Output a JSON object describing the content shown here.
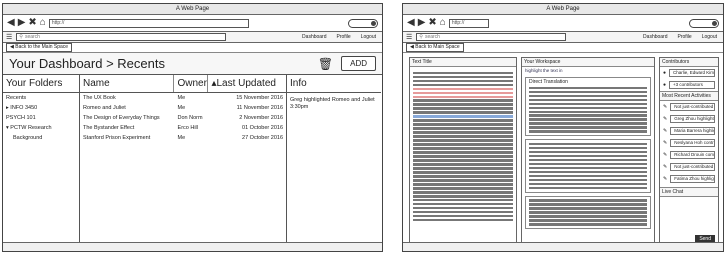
{
  "window": {
    "title": "A Web Page",
    "url": "http://"
  },
  "appbar": {
    "search_placeholder": "search",
    "links": [
      "Dashboard",
      "Profile",
      "Logout"
    ]
  },
  "crumb": {
    "back_label": "Back to the Main Space"
  },
  "dashboard": {
    "title": "Your Dashboard > Recents",
    "add_label": "ADD"
  },
  "folders": {
    "header": "Your Folders",
    "items": [
      "Recents",
      "▸ INFO 3450",
      "PSYCH 101",
      "▾ PCTW Research",
      "Background"
    ]
  },
  "table": {
    "headers": [
      "Name",
      "Owner",
      "▴Last Updated"
    ],
    "rows": [
      [
        "The UX Book",
        "Me",
        "15 November 2016"
      ],
      [
        "Romeo and Juliet",
        "Me",
        "11 November 2016"
      ],
      [
        "The Design of Everyday Things",
        "Don Norm",
        "2 November 2016"
      ],
      [
        "The Bystander Effect",
        "Erco Hill",
        "01 October 2016"
      ],
      [
        "Stanford Prison Experiment",
        "Me",
        "27 October 2016"
      ]
    ]
  },
  "info": {
    "header": "Info",
    "text": "Greg highlighted Romeo and Juliet 3:30pm"
  },
  "right": {
    "title": "A Web Page",
    "search_placeholder": "search",
    "links": [
      "Dashboard",
      "Profile",
      "Logout"
    ],
    "back_label": "Back to Main Space",
    "text_title": "Text Title",
    "workspace_title": "Your Workspace",
    "workspace_note": "highlight the text in",
    "direct_translation": "Direct Translation",
    "contributors_title": "Contributors",
    "contributors": [
      "Charlie, Edward Kim",
      "+3 contributors"
    ],
    "recent_title": "Most Recent Activities",
    "activities": [
      "Not just-contributed",
      "Greg Zhou highlighted",
      "Maria Barrera highlighted",
      "Neslyana Hoh contributed",
      "Richard Drouin commented",
      "Not just-contributed",
      "Fatima Zhou highlighted"
    ],
    "chat_title": "Live Chat",
    "send_label": "Send"
  }
}
